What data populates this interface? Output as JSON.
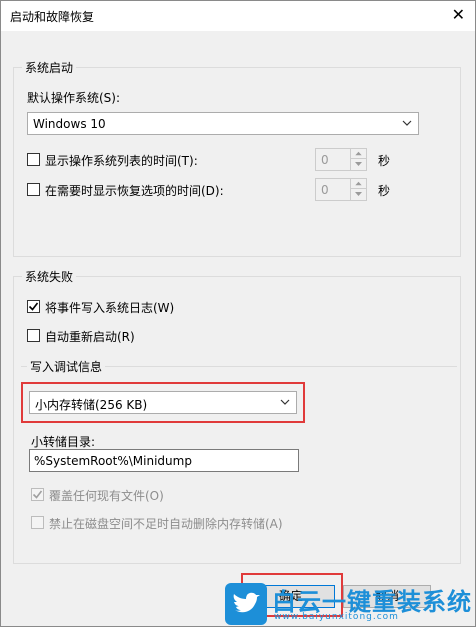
{
  "window": {
    "title": "启动和故障恢复",
    "close_glyph": "✕"
  },
  "startup": {
    "legend": "系统启动",
    "default_os_label": "默认操作系统(S):",
    "default_os_value": "Windows 10",
    "show_list_label": "显示操作系统列表的时间(T):",
    "show_list_value": "0",
    "show_recovery_label": "在需要时显示恢复选项的时间(D):",
    "show_recovery_value": "0",
    "seconds": "秒"
  },
  "failure": {
    "legend": "系统失败",
    "write_event_label": "将事件写入系统日志(W)",
    "write_event_checked": true,
    "auto_restart_label": "自动重新启动(R)",
    "auto_restart_checked": false,
    "debug": {
      "legend": "写入调试信息",
      "dump_type_value": "小内存转储(256 KB)",
      "dump_dir_label": "小转储目录:",
      "dump_dir_value": "%SystemRoot%\\Minidump",
      "overwrite_label": "覆盖任何现有文件(O)",
      "overwrite_checked": true,
      "disable_auto_delete_label": "禁止在磁盘空间不足时自动删除内存转储(A)",
      "disable_auto_delete_checked": false
    }
  },
  "buttons": {
    "ok": "确定",
    "cancel": "取消"
  },
  "watermark": {
    "brand": "白云一键重装系统",
    "url": "www.baiyunxitong.com"
  },
  "colors": {
    "highlight": "#e03a3a",
    "accent": "#0078d7",
    "watermark": "#1d8fd8"
  }
}
